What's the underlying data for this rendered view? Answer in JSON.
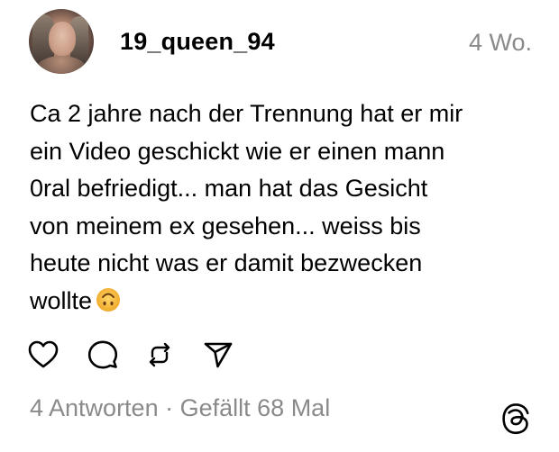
{
  "post": {
    "username": "19_queen_94",
    "timestamp": "4 Wo.",
    "text": "Ca 2 jahre nach der Trennung hat er mir\nein Video geschickt wie er einen mann\n0ral befriedigt... man hat das Gesicht\nvon meinem ex gesehen... weiss bis\nheute nicht was er damit bezwecken\nwollte",
    "emoji": "upside-down-face-emoji"
  },
  "actions": [
    {
      "icon": "heart-icon"
    },
    {
      "icon": "comment-icon"
    },
    {
      "icon": "repost-icon"
    },
    {
      "icon": "share-icon"
    }
  ],
  "stats": {
    "replies": "4 Antworten",
    "separator": "·",
    "likes": "Gefällt 68 Mal"
  },
  "brand": {
    "logo": "threads-logo-icon"
  },
  "colors": {
    "text": "#000000",
    "muted": "#8a8a8a",
    "background": "#ffffff",
    "emoji": "#f5b93a"
  }
}
